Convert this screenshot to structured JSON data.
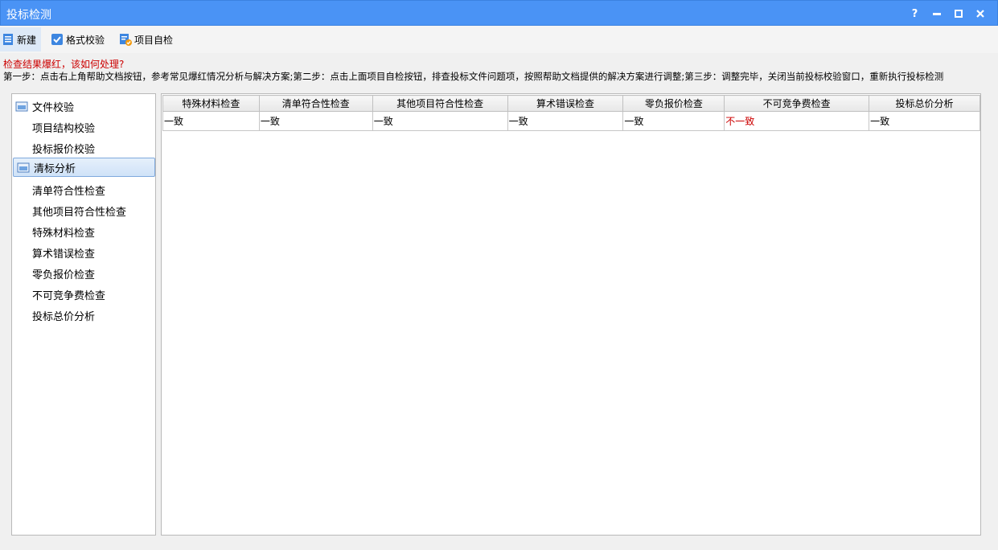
{
  "window": {
    "title": "投标检测",
    "help_glyph": "?",
    "colors": {
      "titlebar": "#4a93f5",
      "error_text": "#cc0000"
    }
  },
  "toolbar": {
    "new_label": "新建",
    "format_check_label": "格式校验",
    "self_check_label": "项目自检"
  },
  "help": {
    "title": "检查结果爆红，该如何处理?",
    "steps": "第一步：点击右上角帮助文档按钮，参考常见爆红情况分析与解决方案;第二步：点击上面项目自检按钮，排查投标文件问题项，按照帮助文档提供的解决方案进行调整;第三步：调整完毕，关闭当前投标校验窗口，重新执行投标检测"
  },
  "tree": {
    "groups": [
      {
        "label": "文件校验",
        "children": [
          "项目结构校验",
          "投标报价校验"
        ]
      },
      {
        "label": "清标分析",
        "selected": true,
        "children": [
          "清单符合性检查",
          "其他项目符合性检查",
          "特殊材料检查",
          "算术错误检查",
          "零负报价检查",
          "不可竞争费检查",
          "投标总价分析"
        ]
      }
    ]
  },
  "grid": {
    "columns": [
      "特殊材料检查",
      "清单符合性检查",
      "其他项目符合性检查",
      "算术错误检查",
      "零负报价检查",
      "不可竞争费检查",
      "投标总价分析"
    ],
    "rows": [
      [
        "一致",
        "一致",
        "一致",
        "一致",
        "一致",
        "不一致",
        "一致"
      ]
    ]
  }
}
